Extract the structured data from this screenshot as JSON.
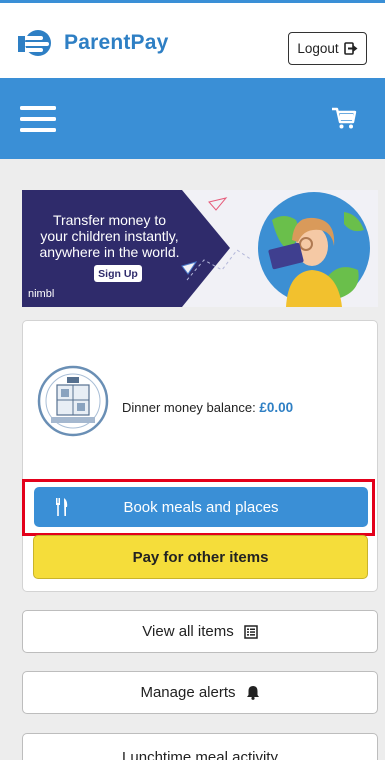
{
  "header": {
    "brand": "ParentPay",
    "logout_label": "Logout"
  },
  "banner": {
    "line1": "Transfer money to",
    "line2": "your children instantly,",
    "line3": "anywhere in the world.",
    "signup_label": "Sign Up",
    "brand": "nimbl"
  },
  "account": {
    "balance_label": "Dinner money balance:",
    "balance_value": "£0.00"
  },
  "actions": {
    "book_label": "Book meals and places",
    "pay_label": "Pay for other items"
  },
  "menu": {
    "view_all_label": "View all items",
    "alerts_label": "Manage alerts",
    "lunch_label": "Lunchtime meal activity"
  },
  "colors": {
    "brand_blue": "#3a8fd6",
    "pay_yellow": "#f5dd3a",
    "highlight_red": "#e3001b"
  }
}
